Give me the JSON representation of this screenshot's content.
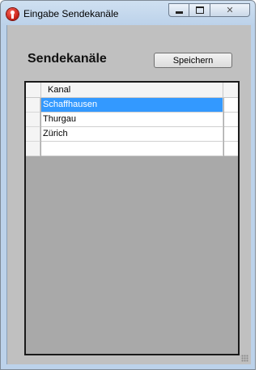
{
  "window": {
    "title": "Eingabe Sendekanäle",
    "icon": "info-icon",
    "controls": [
      "minimize-icon",
      "maximize-icon",
      "close-icon"
    ]
  },
  "main": {
    "heading": "Sendekanäle",
    "save_label": "Speichern"
  },
  "grid": {
    "columns": [
      "Kanal"
    ],
    "rows": [
      {
        "kanal": "Schaffhausen",
        "selected": true
      },
      {
        "kanal": "Thurgau",
        "selected": false
      },
      {
        "kanal": "Zürich",
        "selected": false
      },
      {
        "kanal": "",
        "selected": false
      }
    ],
    "selection_color": "#3399ff"
  }
}
